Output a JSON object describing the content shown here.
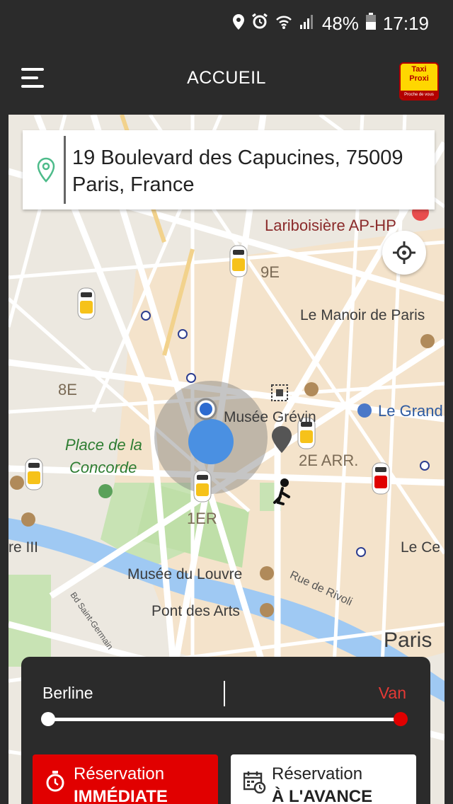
{
  "status_bar": {
    "icons": [
      "location-icon",
      "alarm-icon",
      "wifi-icon",
      "signal-icon"
    ],
    "battery": "48%",
    "time": "17:19"
  },
  "app_bar": {
    "menu_icon": "hamburger-menu-icon",
    "title": "ACCUEIL",
    "logo": {
      "line1": "Taxi",
      "line2": "Proxi",
      "tagline": "Proche de vous"
    }
  },
  "address": {
    "icon": "location-pin-icon",
    "value": "19 Boulevard des Capucines, 75009 Paris, France"
  },
  "map": {
    "labels": {
      "lariboisiere": "Lariboisière AP-HP",
      "9e": "9E",
      "manoir": "Le Manoir de Paris",
      "8e": "8E",
      "musee_grevin": "Musée Grévin",
      "le_grand": "Le Grand",
      "place_concorde_1": "Place de la",
      "place_concorde_2": "Concorde",
      "2e_arr": "2E ARR.",
      "1er": "1ER",
      "re_iii": "re III",
      "le_ce": "Le Ce",
      "bd_saint_germain": "Bd Saint-Germain",
      "musee_louvre": "Musée du Louvre",
      "rue_rivoli": "Rue de Rivoli",
      "pont_arts": "Pont des Arts",
      "paris": "Paris"
    },
    "accent_blue": "#4a90e2",
    "taxi_yellow": "#f6c21a",
    "taxi_red": "#e00000"
  },
  "vehicle_selector": {
    "left_label": "Berline",
    "right_label": "Van",
    "selected": "Van"
  },
  "buttons": {
    "immediate": {
      "line1": "Réservation",
      "line2": "IMMÉDIATE",
      "icon": "stopwatch-icon"
    },
    "advance": {
      "line1": "Réservation",
      "line2": "À L'AVANCE",
      "icon": "calendar-clock-icon"
    }
  },
  "colors": {
    "bar_bg": "#2b2b2b",
    "primary_red": "#e10000",
    "map_bg": "#ece8e0"
  }
}
